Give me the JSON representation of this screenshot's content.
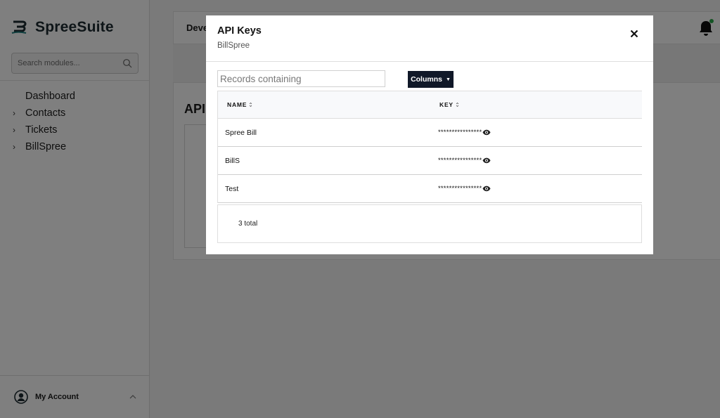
{
  "app": {
    "brand": "SpreeSuite",
    "search_placeholder": "Search modules...",
    "nav": [
      {
        "label": "Dashboard",
        "has_children": false
      },
      {
        "label": "Contacts",
        "has_children": true
      },
      {
        "label": "Tickets",
        "has_children": true
      },
      {
        "label": "BillSpree",
        "has_children": true
      }
    ],
    "account_label": "My Account"
  },
  "main": {
    "topbar_title": "Deve",
    "card_title": "API"
  },
  "modal": {
    "title": "API Keys",
    "subtitle": "BillSpree",
    "filter_placeholder": "Records containing",
    "columns_label": "Columns",
    "table": {
      "headers": [
        "NAME",
        "KEY"
      ],
      "rows": [
        {
          "name": "Spree Bill",
          "key": "****************"
        },
        {
          "name": "BillS",
          "key": "****************"
        },
        {
          "name": "Test",
          "key": "****************"
        }
      ]
    },
    "total_text": "3 total"
  },
  "colors": {
    "overlay": "#808080",
    "button_bg": "#101828",
    "notification_dot": "#2aa84a"
  }
}
